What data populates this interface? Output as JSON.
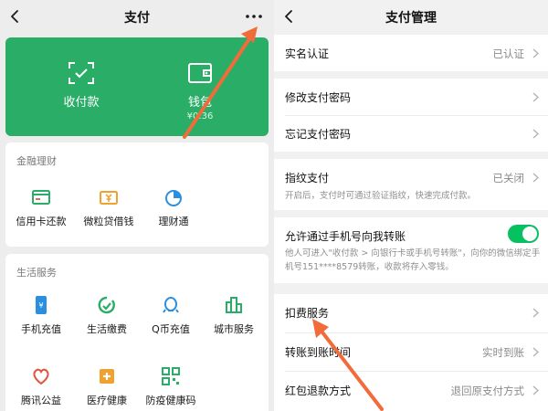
{
  "left": {
    "title": "支付",
    "green_card": {
      "receive_label": "收付款",
      "wallet_label": "钱包",
      "wallet_balance": "¥0.36"
    },
    "finance": {
      "title": "金融理财",
      "items": [
        {
          "label": "信用卡还款",
          "icon": "credit-card-icon"
        },
        {
          "label": "微粒贷借钱",
          "icon": "loan-icon"
        },
        {
          "label": "理财通",
          "icon": "wealth-icon"
        }
      ]
    },
    "life": {
      "title": "生活服务",
      "items": [
        {
          "label": "手机充值",
          "icon": "phone-icon"
        },
        {
          "label": "生活缴费",
          "icon": "utility-icon"
        },
        {
          "label": "Q币充值",
          "icon": "qq-icon"
        },
        {
          "label": "城市服务",
          "icon": "city-icon"
        },
        {
          "label": "腾讯公益",
          "icon": "charity-icon"
        },
        {
          "label": "医疗健康",
          "icon": "medical-icon"
        },
        {
          "label": "防疫健康码",
          "icon": "qr-code-icon"
        }
      ]
    }
  },
  "right": {
    "title": "支付管理",
    "rows": {
      "real_name": {
        "label": "实名认证",
        "value": "已认证"
      },
      "change_password": {
        "label": "修改支付密码"
      },
      "forgot_password": {
        "label": "忘记支付密码"
      },
      "fingerprint": {
        "label": "指纹支付",
        "value": "已关闭",
        "note": "开启后，支付时可通过验证指纹，快速完成付款。"
      },
      "phone_transfer": {
        "label": "允许通过手机号向我转账",
        "note": "他人可进入\"收付款 > 向银行卡或手机号转账\"，向你的微信绑定手机号151****8579转账，收款将存入零钱。",
        "enabled": true
      },
      "deduction": {
        "label": "扣费服务"
      },
      "arrival_time": {
        "label": "转账到账时间",
        "value": "实时到账"
      },
      "red_packet_refund": {
        "label": "红包退款方式",
        "value": "退回原支付方式"
      }
    }
  },
  "colors": {
    "accent_green": "#2aae67",
    "toggle_green": "#07c160",
    "annotation_arrow": "#f26b3a"
  }
}
